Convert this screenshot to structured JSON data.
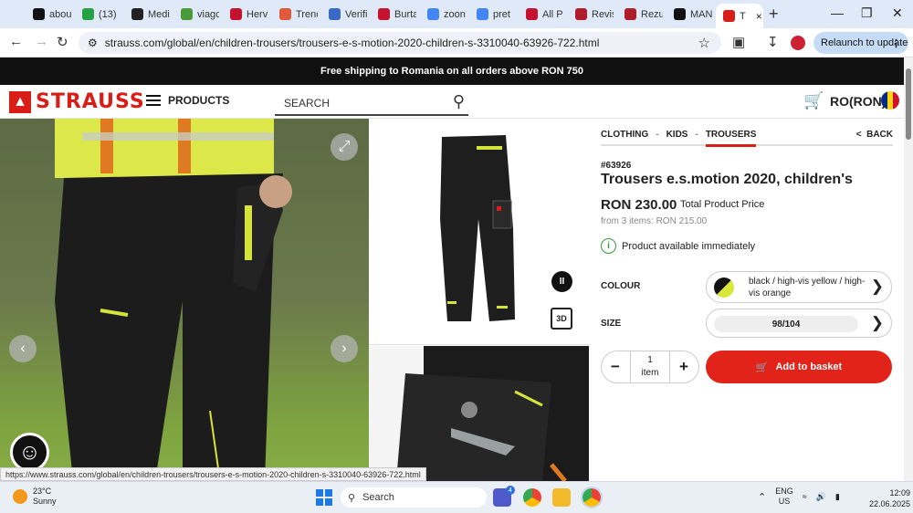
{
  "browser": {
    "tabs": [
      {
        "label": "abou",
        "color": "#111111"
      },
      {
        "label": "(13)",
        "color": "#25a244"
      },
      {
        "label": "Medi",
        "color": "#222222"
      },
      {
        "label": "viagc",
        "color": "#4a9a3a"
      },
      {
        "label": "Herv",
        "color": "#c4122f"
      },
      {
        "label": "Trenc",
        "color": "#e05a3a"
      },
      {
        "label": "Verifi",
        "color": "#3a6ac8"
      },
      {
        "label": "Burta",
        "color": "#c4122f"
      },
      {
        "label": "zoon",
        "color": "#4285f4"
      },
      {
        "label": "pret",
        "color": "#4285f4"
      },
      {
        "label": "All P",
        "color": "#c4122f"
      },
      {
        "label": "Revis",
        "color": "#b01d2a"
      },
      {
        "label": "Rezu",
        "color": "#b01d2a"
      },
      {
        "label": "MAN",
        "color": "#111111"
      },
      {
        "label": "T",
        "color": "#d91e18"
      }
    ],
    "new_tab": "+",
    "url": "strauss.com/global/en/children-trousers/trousers-e-s-motion-2020-children-s-3310040-63926-722.html",
    "relaunch_label": "Relaunch to update",
    "status_url": "https://www.strauss.com/global/en/children-trousers/trousers-e-s-motion-2020-children-s-3310040-63926-722.html"
  },
  "site": {
    "promo": "Free shipping to Romania on all orders above RON 750",
    "logo_text": "STRAUSS",
    "products_label": "PRODUCTS",
    "search_placeholder": "SEARCH",
    "region": "RO(RON)",
    "flag_colors": [
      "#002b7f",
      "#fcd116",
      "#ce1126"
    ]
  },
  "product": {
    "breadcrumbs": [
      "CLOTHING",
      "KIDS",
      "TROUSERS"
    ],
    "back_label": "BACK",
    "sku": "#63926",
    "title": "Trousers e.s.motion 2020, children's",
    "price": "RON 230.00",
    "price_label": "Total Product Price",
    "tier_price": "from 3 items: RON 215.00",
    "availability": "Product available immediately",
    "colour_label": "COLOUR",
    "colour_value": "black / high-vis yellow / high-vis orange",
    "size_label": "SIZE",
    "size_value": "98/104",
    "quantity": "1",
    "quantity_unit": "item",
    "add_to_basket": "Add to basket",
    "badge_3d": "3D",
    "accent": "#e2231a"
  },
  "taskbar": {
    "temperature": "23°C",
    "weather": "Sunny",
    "search_placeholder": "Search",
    "teams_badge": "4",
    "lang_line1": "ENG",
    "lang_line2": "US",
    "time": "12:09",
    "date": "22.06.2025"
  }
}
